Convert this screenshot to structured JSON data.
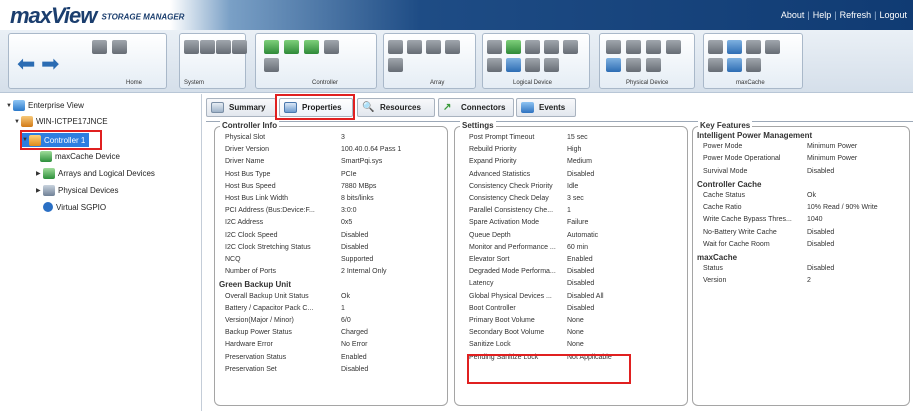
{
  "header": {
    "logo_main": "maxView",
    "logo_sub": "STORAGE MANAGER",
    "links": [
      "About",
      "Help",
      "Refresh",
      "Logout"
    ]
  },
  "ribbon": {
    "groups": [
      "Home",
      "System",
      "Controller",
      "Array",
      "Logical Device",
      "Physical Device",
      "maxCache"
    ]
  },
  "tree": {
    "root": "Enterprise View",
    "host": "WIN-ICTPE17JNCE",
    "controller": "Controller 1",
    "items": [
      "maxCache Device",
      "Arrays and Logical Devices",
      "Physical Devices",
      "Virtual SGPIO"
    ]
  },
  "tabs": [
    "Summary",
    "Properties",
    "Resources",
    "Connectors",
    "Events"
  ],
  "controller_info": {
    "title": "Controller Info",
    "rows": [
      {
        "k": "Physical Slot",
        "v": "3"
      },
      {
        "k": "Driver Version",
        "v": "100.40.0.64 Pass 1"
      },
      {
        "k": "Driver Name",
        "v": "SmartPqi.sys"
      },
      {
        "k": "Host Bus Type",
        "v": "PCIe"
      },
      {
        "k": "Host Bus Speed",
        "v": "7880 MBps"
      },
      {
        "k": "Host Bus Link Width",
        "v": "8 bits/links"
      },
      {
        "k": "PCI Address (Bus:Device:F...",
        "v": "3:0:0"
      },
      {
        "k": "I2C Address",
        "v": "0x5"
      },
      {
        "k": "I2C Clock Speed",
        "v": "Disabled"
      },
      {
        "k": "I2C Clock Stretching Status",
        "v": "Disabled"
      },
      {
        "k": "NCQ",
        "v": "Supported"
      },
      {
        "k": "Number of Ports",
        "v": "2 Internal Only"
      }
    ],
    "section": "Green Backup Unit",
    "rows2": [
      {
        "k": "Overall Backup Unit Status",
        "v": "Ok"
      },
      {
        "k": "Battery / Capacitor Pack C...",
        "v": "1"
      },
      {
        "k": "Version(Major / Minor)",
        "v": "6/0"
      },
      {
        "k": "Backup Power Status",
        "v": "Charged"
      },
      {
        "k": "Hardware Error",
        "v": "No Error"
      },
      {
        "k": "Preservation Status",
        "v": "Enabled"
      },
      {
        "k": "Preservation Set",
        "v": "Disabled"
      }
    ]
  },
  "settings": {
    "title": "Settings",
    "rows": [
      {
        "k": "Post Prompt Timeout",
        "v": "15 sec"
      },
      {
        "k": "Rebuild Priority",
        "v": "High"
      },
      {
        "k": "Expand Priority",
        "v": "Medium"
      },
      {
        "k": "Advanced Statistics",
        "v": "Disabled"
      },
      {
        "k": "Consistency Check Priority",
        "v": "Idle"
      },
      {
        "k": "Consistency Check Delay",
        "v": "3 sec"
      },
      {
        "k": "Parallel Consistency Che...",
        "v": "1"
      },
      {
        "k": "Spare Activation Mode",
        "v": "Failure"
      },
      {
        "k": "Queue Depth",
        "v": "Automatic"
      },
      {
        "k": "Monitor and Performance ...",
        "v": "60 min"
      },
      {
        "k": "Elevator Sort",
        "v": "Enabled"
      },
      {
        "k": "Degraded Mode Performa...",
        "v": "Disabled"
      },
      {
        "k": "Latency",
        "v": "Disabled"
      },
      {
        "k": "Global Physical Devices ...",
        "v": "Disabled All"
      },
      {
        "k": "Boot Controller",
        "v": "Disabled"
      },
      {
        "k": "Primary Boot Volume",
        "v": "None"
      },
      {
        "k": "Secondary Boot Volume",
        "v": "None"
      },
      {
        "k": "Sanitize Lock",
        "v": "None"
      },
      {
        "k": "Pending Sanitize Lock",
        "v": "Not Applicable"
      }
    ]
  },
  "key_features": {
    "title": "Key Features",
    "s1": "Intelligent Power Management",
    "rows1": [
      {
        "k": "Power Mode",
        "v": "Minimum Power"
      },
      {
        "k": "Power Mode Operational",
        "v": "Minimum Power"
      },
      {
        "k": "Survival Mode",
        "v": "Disabled"
      }
    ],
    "s2": "Controller Cache",
    "rows2": [
      {
        "k": "Cache Status",
        "v": "Ok"
      },
      {
        "k": "Cache Ratio",
        "v": "10% Read / 90% Write"
      },
      {
        "k": "Write Cache Bypass Thres...",
        "v": "1040"
      },
      {
        "k": "No-Battery Write Cache",
        "v": "Disabled"
      },
      {
        "k": "Wait for Cache Room",
        "v": "Disabled"
      }
    ],
    "s3": "maxCache",
    "rows3": [
      {
        "k": "Status",
        "v": "Disabled"
      },
      {
        "k": "Version",
        "v": "2"
      }
    ]
  }
}
